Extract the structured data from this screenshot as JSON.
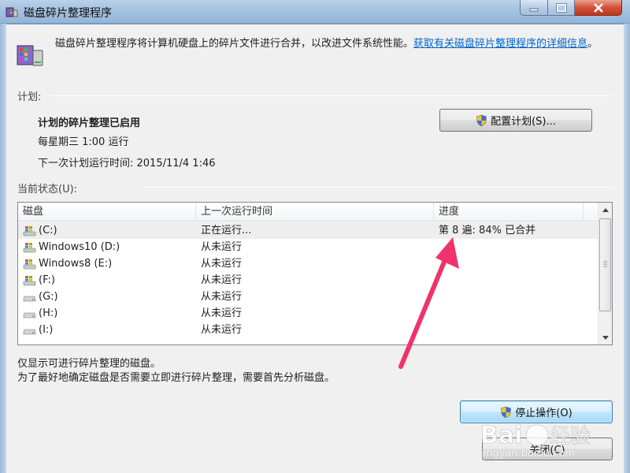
{
  "window": {
    "title": "磁盘碎片整理程序"
  },
  "intro": {
    "text": "磁盘碎片整理程序将计算机硬盘上的碎片文件进行合并，以改进文件系统性能。",
    "link": "获取有关磁盘碎片整理程序的详细信息",
    "suffix": "。"
  },
  "schedule": {
    "section_label": "计划:",
    "status": "计划的碎片整理已启用",
    "frequency": "每星期三  1:00 运行",
    "next_run": "下一次计划运行时间: 2015/11/4 1:46",
    "configure_button": "配置计划(S)..."
  },
  "current_status": {
    "section_label": "当前状态(U):",
    "columns": [
      "磁盘",
      "上一次运行时间",
      "进度"
    ],
    "rows": [
      {
        "disk": "(C:)",
        "last_run": "正在运行...",
        "progress": "第 8 遍: 84% 已合并",
        "icon": "windows-drive-icon"
      },
      {
        "disk": "Windows10 (D:)",
        "last_run": "从未运行",
        "progress": "",
        "icon": "windows-drive-icon"
      },
      {
        "disk": "Windows8 (E:)",
        "last_run": "从未运行",
        "progress": "",
        "icon": "windows-drive-icon"
      },
      {
        "disk": "(F:)",
        "last_run": "从未运行",
        "progress": "",
        "icon": "windows-drive-icon"
      },
      {
        "disk": "(G:)",
        "last_run": "从未运行",
        "progress": "",
        "icon": "hard-drive-icon"
      },
      {
        "disk": "(H:)",
        "last_run": "从未运行",
        "progress": "",
        "icon": "hard-drive-icon"
      },
      {
        "disk": "(I:)",
        "last_run": "从未运行",
        "progress": "",
        "icon": "hard-drive-icon"
      }
    ]
  },
  "notes": {
    "line1": "仅显示可进行碎片整理的磁盘。",
    "line2": "为了最好地确定磁盘是否需要立即进行碎片整理，需要首先分析磁盘。"
  },
  "buttons": {
    "stop": "停止操作(O)",
    "close": "关闭(C)"
  },
  "watermark": {
    "brand": "Bai 经验",
    "url": "jingyan.baidu.com"
  },
  "colors": {
    "accent_arrow": "#f0336a",
    "link": "#0066cc",
    "title_bar": "#a3c0df"
  }
}
